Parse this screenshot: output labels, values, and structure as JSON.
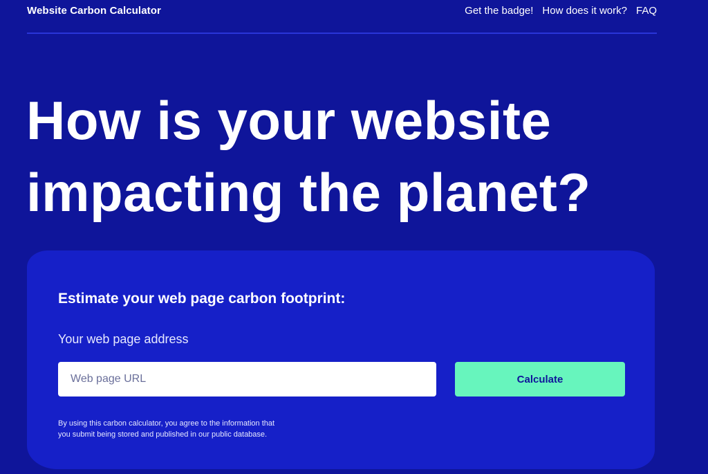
{
  "nav": {
    "brand": "Website Carbon Calculator",
    "links": [
      "Get the badge!",
      "How does it work?",
      "FAQ"
    ]
  },
  "hero": {
    "line1": "How is your website",
    "line2": "impacting the planet?"
  },
  "form": {
    "heading": "Estimate your web page carbon footprint:",
    "label": "Your web page address",
    "placeholder": "Web page URL",
    "value": "",
    "button_label": "Calculate",
    "disclaimer_line1": "By using this carbon calculator, you agree to the information that",
    "disclaimer_line2": "you submit being stored and published in our public database."
  },
  "colors": {
    "background": "#0f159a",
    "card": "#1620c8",
    "accent": "#67f5bd",
    "text": "#ffffff"
  }
}
